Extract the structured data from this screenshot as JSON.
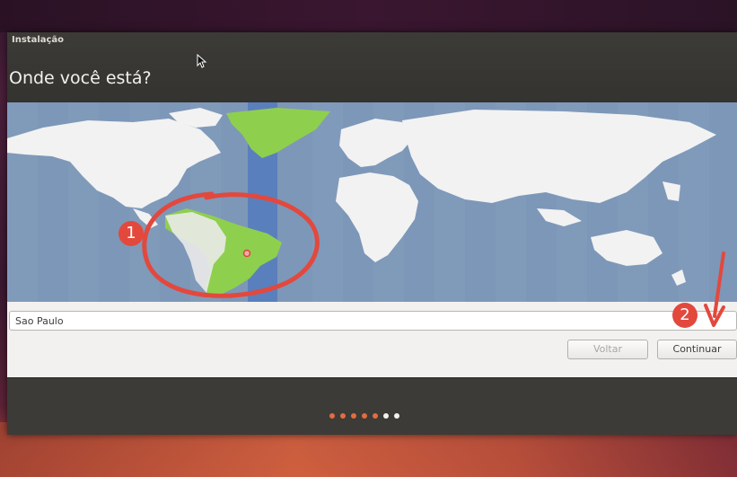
{
  "window": {
    "title": "Instalação",
    "heading": "Onde você está?"
  },
  "location": {
    "value": "Sao Paulo"
  },
  "buttons": {
    "back": "Voltar",
    "continue": "Continuar"
  },
  "progress": {
    "completed_steps": 5,
    "total_steps": 7
  },
  "annotations": {
    "badge1": "1",
    "badge2": "2"
  },
  "colors": {
    "highlight_land": "#8fcf4e",
    "selected_timezone_band": "#5a7fbd",
    "ocean": "#7d97b8",
    "land": "#f2f2f2",
    "annotation_red": "#e3483d",
    "progress_done": "#e26d3f"
  }
}
